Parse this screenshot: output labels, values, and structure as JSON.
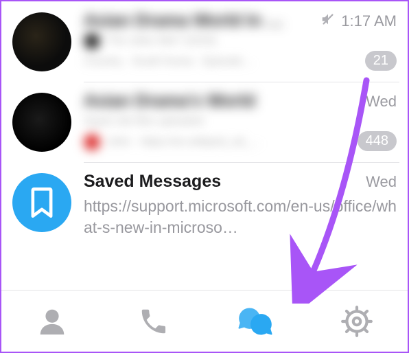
{
  "chats": [
    {
      "title": "Asian Drama World In …",
      "time": "1:17 AM",
      "muted": true,
      "badge": "21",
      "preview1": "The video title? (2020)",
      "preview2": "Country · South Korea · Episode…"
    },
    {
      "title": "Asian Drama's World",
      "time": "Wed",
      "muted": false,
      "badge": "448",
      "preview1": "Squid Job files uploaded",
      "preview2": "John · https://en.wikiped_od_…"
    },
    {
      "title": "Saved Messages",
      "time": "Wed",
      "muted": false,
      "badge": "",
      "preview": "https://support.microsoft.com/en-us/office/what-s-new-in-microso…"
    }
  ],
  "tabbar": {
    "contacts": "contacts",
    "calls": "calls",
    "chats": "chats",
    "settings": "settings"
  },
  "annotation": {
    "color": "#a855f7"
  }
}
